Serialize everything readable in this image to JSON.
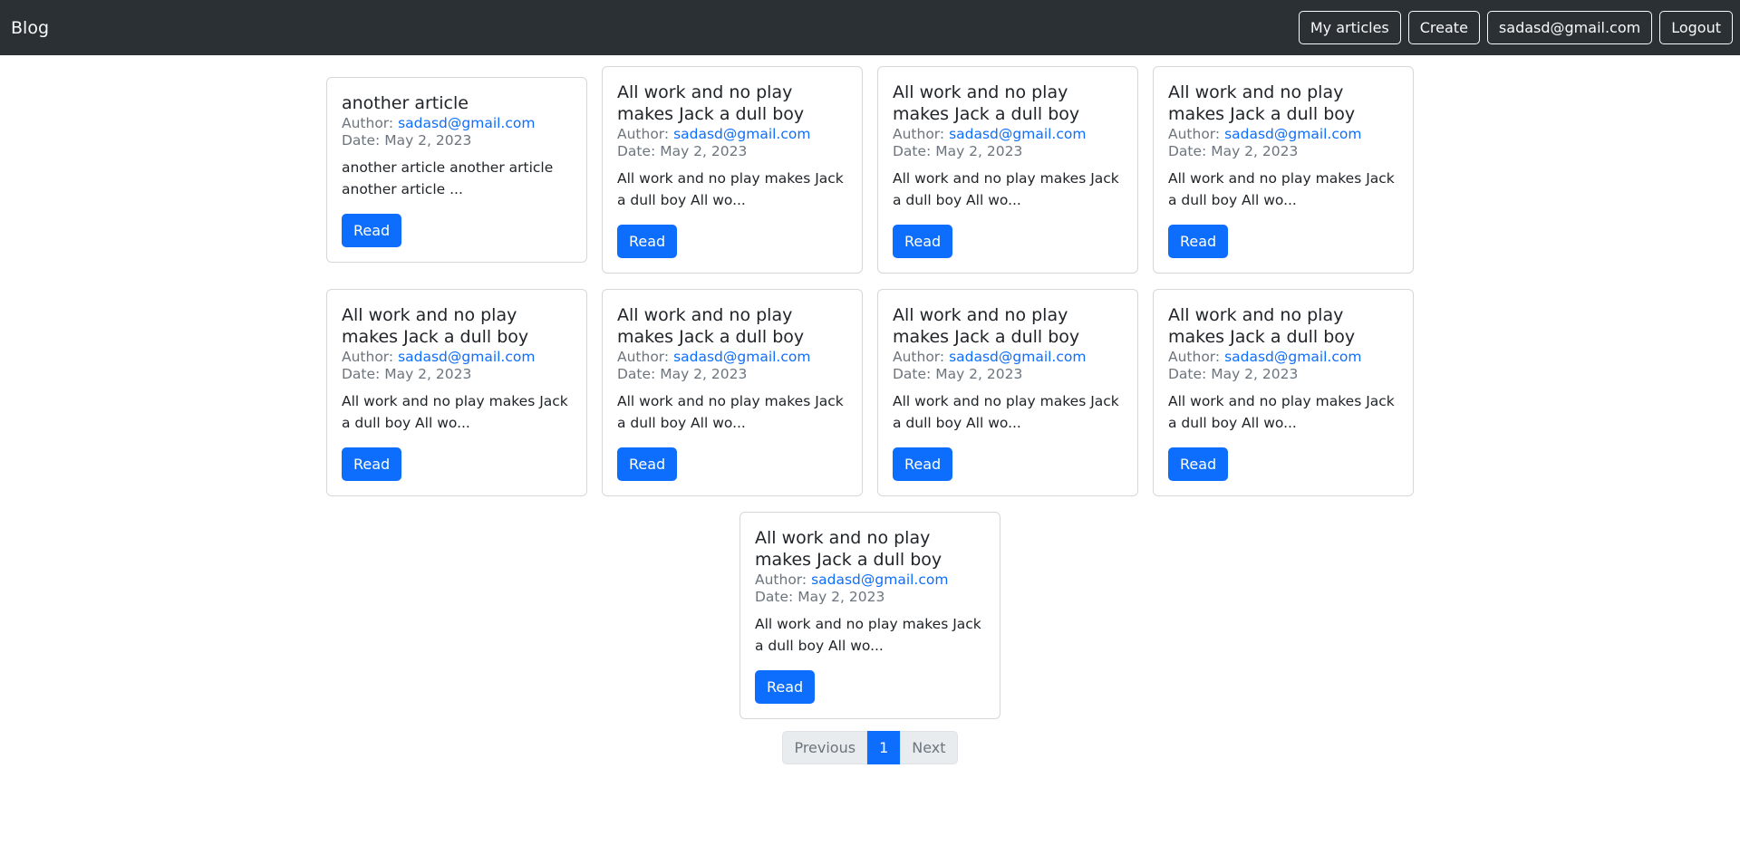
{
  "navbar": {
    "brand": "Blog",
    "buttons": [
      "My articles",
      "Create",
      "sadasd@gmail.com",
      "Logout"
    ]
  },
  "labels": {
    "author": "Author: ",
    "date": "Date: ",
    "read": "Read"
  },
  "articles": [
    {
      "title": "another article",
      "author": "sadasd@gmail.com",
      "date": "May 2, 2023",
      "excerpt": "another article another article another article ..."
    },
    {
      "title": "All work and no play makes Jack a dull boy",
      "author": "sadasd@gmail.com",
      "date": "May 2, 2023",
      "excerpt": "All work and no play makes Jack a dull boy All wo..."
    },
    {
      "title": "All work and no play makes Jack a dull boy",
      "author": "sadasd@gmail.com",
      "date": "May 2, 2023",
      "excerpt": "All work and no play makes Jack a dull boy All wo..."
    },
    {
      "title": "All work and no play makes Jack a dull boy",
      "author": "sadasd@gmail.com",
      "date": "May 2, 2023",
      "excerpt": "All work and no play makes Jack a dull boy All wo..."
    },
    {
      "title": "All work and no play makes Jack a dull boy",
      "author": "sadasd@gmail.com",
      "date": "May 2, 2023",
      "excerpt": "All work and no play makes Jack a dull boy All wo..."
    },
    {
      "title": "All work and no play makes Jack a dull boy",
      "author": "sadasd@gmail.com",
      "date": "May 2, 2023",
      "excerpt": "All work and no play makes Jack a dull boy All wo..."
    },
    {
      "title": "All work and no play makes Jack a dull boy",
      "author": "sadasd@gmail.com",
      "date": "May 2, 2023",
      "excerpt": "All work and no play makes Jack a dull boy All wo..."
    },
    {
      "title": "All work and no play makes Jack a dull boy",
      "author": "sadasd@gmail.com",
      "date": "May 2, 2023",
      "excerpt": "All work and no play makes Jack a dull boy All wo..."
    },
    {
      "title": "All work and no play makes Jack a dull boy",
      "author": "sadasd@gmail.com",
      "date": "May 2, 2023",
      "excerpt": "All work and no play makes Jack a dull boy All wo..."
    }
  ],
  "pagination": {
    "previous": "Previous",
    "current": "1",
    "next": "Next"
  }
}
